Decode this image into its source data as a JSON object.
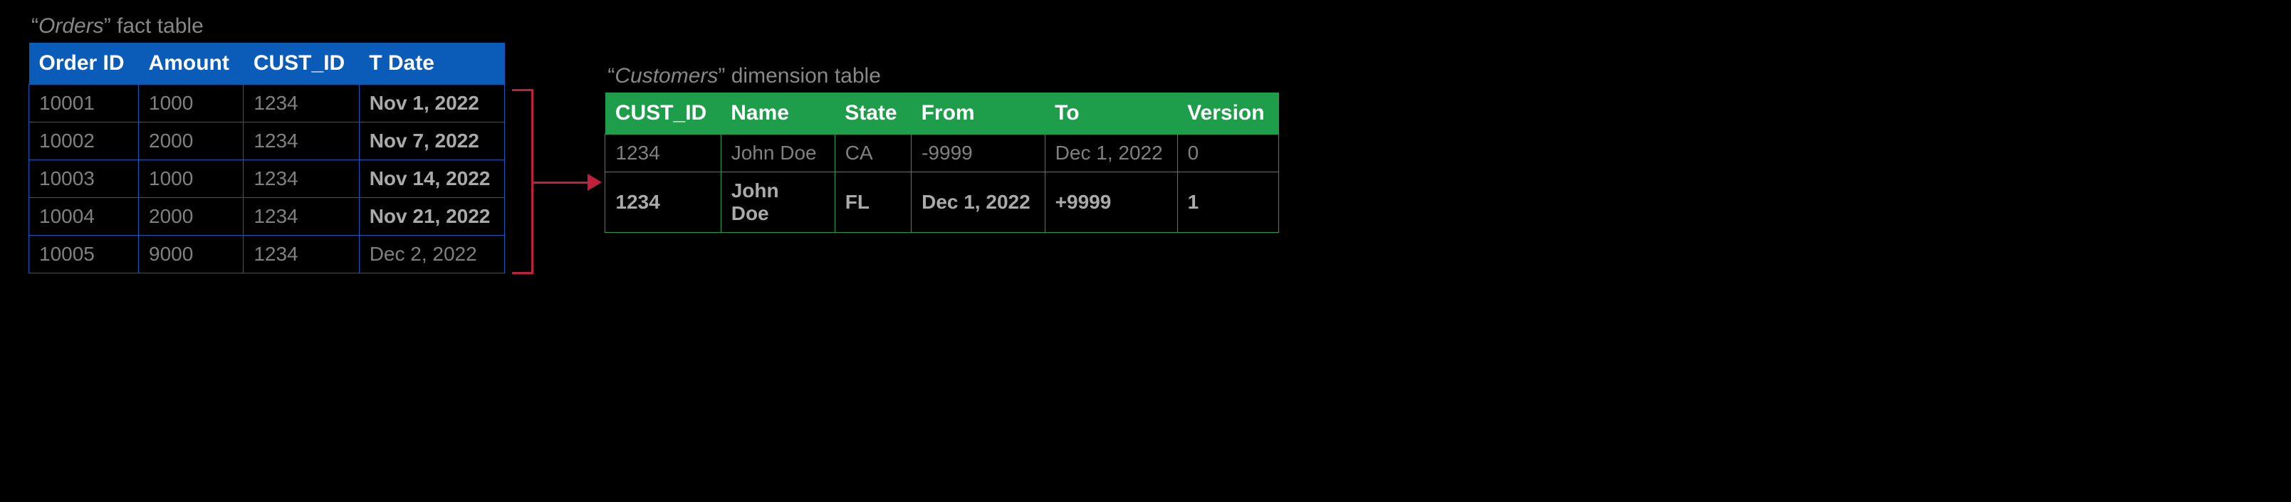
{
  "orders": {
    "caption_prefix": "“",
    "caption_name": "Orders",
    "caption_suffix": "” fact table",
    "columns": [
      "Order ID",
      "Amount",
      "CUST_ID",
      "T Date"
    ],
    "rows": [
      {
        "order_id": "10001",
        "amount": "1000",
        "cust_id": "1234",
        "t_date": "Nov 1, 2022",
        "bold_date": true
      },
      {
        "order_id": "10002",
        "amount": "2000",
        "cust_id": "1234",
        "t_date": "Nov 7, 2022",
        "bold_date": true
      },
      {
        "order_id": "10003",
        "amount": "1000",
        "cust_id": "1234",
        "t_date": "Nov 14, 2022",
        "bold_date": true
      },
      {
        "order_id": "10004",
        "amount": "2000",
        "cust_id": "1234",
        "t_date": "Nov 21, 2022",
        "bold_date": true
      },
      {
        "order_id": "10005",
        "amount": "9000",
        "cust_id": "1234",
        "t_date": "Dec 2, 2022",
        "bold_date": false
      }
    ]
  },
  "customers": {
    "caption_prefix": "“",
    "caption_name": "Customers",
    "caption_suffix": "” dimension table",
    "columns": [
      "CUST_ID",
      "Name",
      "State",
      "From",
      "To",
      "Version"
    ],
    "rows": [
      {
        "cust_id": "1234",
        "name": "John Doe",
        "state": "CA",
        "from": "-9999",
        "to": "Dec 1, 2022",
        "version": "0",
        "bold": false
      },
      {
        "cust_id": "1234",
        "name": "John Doe",
        "state": "FL",
        "from": "Dec 1, 2022",
        "to": "+9999",
        "version": "1",
        "bold": true
      }
    ]
  }
}
